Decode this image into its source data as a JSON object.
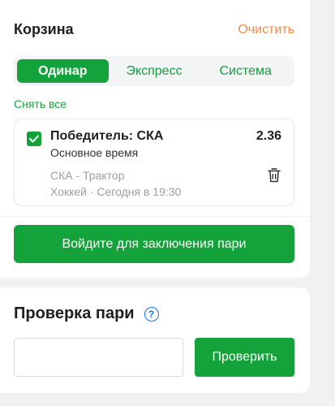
{
  "cart": {
    "title": "Корзина",
    "clear_label": "Очистить",
    "tabs": [
      {
        "label": "Одинар",
        "active": true
      },
      {
        "label": "Экспресс",
        "active": false
      },
      {
        "label": "Система",
        "active": false
      }
    ],
    "remove_all_label": "Снять все",
    "bet": {
      "checked": true,
      "title": "Победитель: СКА",
      "odds": "2.36",
      "period": "Основное время",
      "match": "СКА - Трактор",
      "meta": "Хоккей · Сегодня в 19:30"
    },
    "login_button_label": "Войдите для заключения пари"
  },
  "bet_check": {
    "title": "Проверка пари",
    "help_icon": "question-circle-icon",
    "input_value": "",
    "input_placeholder": "",
    "check_button_label": "Проверить"
  },
  "colors": {
    "accent_green": "#14a33a",
    "clear_orange": "#f28c48",
    "help_blue": "#1a73e8"
  }
}
